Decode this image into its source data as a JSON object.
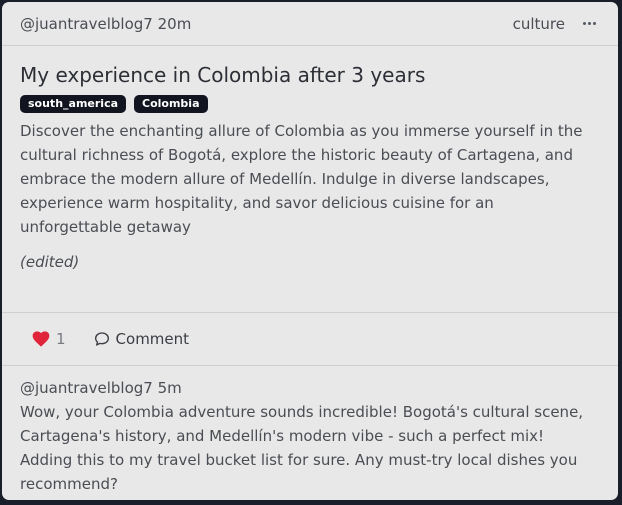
{
  "post": {
    "author": "@juantravelblog7",
    "time": "20m",
    "category": "culture",
    "title": "My experience in Colombia after 3 years",
    "tags": [
      "south_america",
      "Colombia"
    ],
    "description": "Discover the enchanting allure of Colombia as you immerse yourself in the cultural richness of Bogotá, explore the historic beauty of Cartagena, and embrace the modern allure of Medellín. Indulge in diverse landscapes, experience warm hospitality, and savor delicious cuisine for an unforgettable getaway",
    "edited_label": "(edited)"
  },
  "actions": {
    "like_icon": "heart-icon",
    "like_color": "#e0253a",
    "like_count": "1",
    "comment_icon": "speech-bubble-icon",
    "comment_label": "Comment"
  },
  "comments": [
    {
      "author": "@juantravelblog7",
      "time": "5m",
      "text": "Wow, your Colombia adventure sounds incredible! Bogotá's cultural scene, Cartagena's history, and Medellín's modern vibe - such a perfect mix! Adding this to my travel bucket list for sure. Any must-try local dishes you recommend?"
    }
  ]
}
